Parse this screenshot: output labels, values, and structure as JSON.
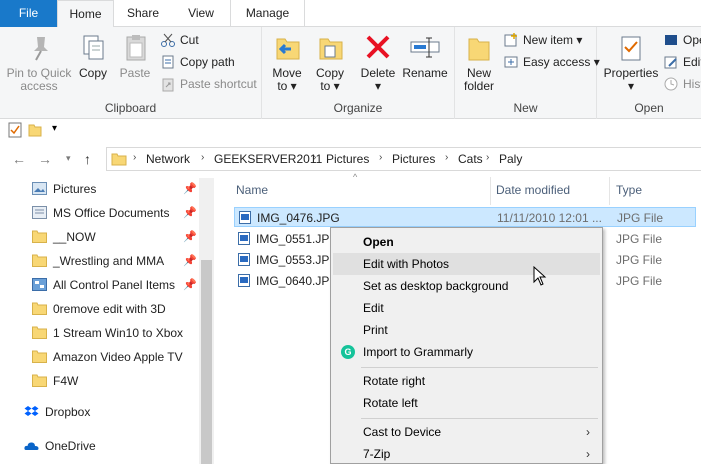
{
  "ribbon_tabs": [
    "File",
    "Home",
    "Share",
    "View",
    "Manage"
  ],
  "clipboard": {
    "pin": "Pin to Quick\naccess",
    "pin_l1": "Pin to Quick",
    "pin_l2": "access",
    "copy": "Copy",
    "paste": "Paste",
    "cut": "Cut",
    "copy_path": "Copy path",
    "paste_shortcut": "Paste shortcut",
    "label": "Clipboard"
  },
  "organize": {
    "move_to": "Move",
    "move_to_2": "to",
    "copy_to": "Copy",
    "copy_to_2": "to",
    "delete": "Delete",
    "rename": "Rename",
    "label": "Organize"
  },
  "new": {
    "new_folder_1": "New",
    "new_folder_2": "folder",
    "new_item": "New item",
    "easy_access": "Easy access",
    "label": "New"
  },
  "open": {
    "properties": "Properties",
    "open_partial": "Ope",
    "edit_partial": "Edit",
    "history_partial": "Hist",
    "label": "Open"
  },
  "address": {
    "crumbs": [
      "Network",
      "GEEKSERVER2011",
      "Pictures",
      "Pictures",
      "Cats",
      "Paly"
    ]
  },
  "nav_pane": {
    "items": [
      {
        "label": "Pictures",
        "pinned": true
      },
      {
        "label": "MS Office Documents",
        "pinned": true
      },
      {
        "label": "__NOW",
        "pinned": true
      },
      {
        "label": "_Wrestling and MMA",
        "pinned": true
      },
      {
        "label": "All Control Panel Items",
        "pinned": true
      },
      {
        "label": "0remove edit with 3D",
        "pinned": false
      },
      {
        "label": "1 Stream Win10 to Xbox",
        "pinned": false
      },
      {
        "label": "Amazon Video Apple TV",
        "pinned": false
      },
      {
        "label": "F4W",
        "pinned": false
      }
    ],
    "dropbox": "Dropbox",
    "onedrive": "OneDrive"
  },
  "file_list": {
    "columns": {
      "name": "Name",
      "date": "Date modified",
      "type": "Type"
    },
    "rows": [
      {
        "name": "IMG_0476.JPG",
        "date": "11/11/2010 12:01 ...",
        "type": "JPG File",
        "selected": true
      },
      {
        "name": "IMG_0551.JPG",
        "date": "",
        "type": "JPG File",
        "selected": false
      },
      {
        "name": "IMG_0553.JPG",
        "date": "",
        "type": "JPG File",
        "selected": false
      },
      {
        "name": "IMG_0640.JPG",
        "date": "",
        "type": "JPG File",
        "selected": false
      }
    ]
  },
  "context_menu": {
    "open": "Open",
    "edit_photos": "Edit with Photos",
    "set_background": "Set as desktop background",
    "edit": "Edit",
    "print": "Print",
    "grammarly": "Import to Grammarly",
    "rotate_right": "Rotate right",
    "rotate_left": "Rotate left",
    "cast": "Cast to Device",
    "zip": "7-Zip"
  },
  "colors": {
    "file_tab": "#1979ca",
    "selection": "#cce8ff",
    "folder": "#f8d775",
    "delete_red": "#e81123",
    "grammarly": "#15c39a"
  }
}
